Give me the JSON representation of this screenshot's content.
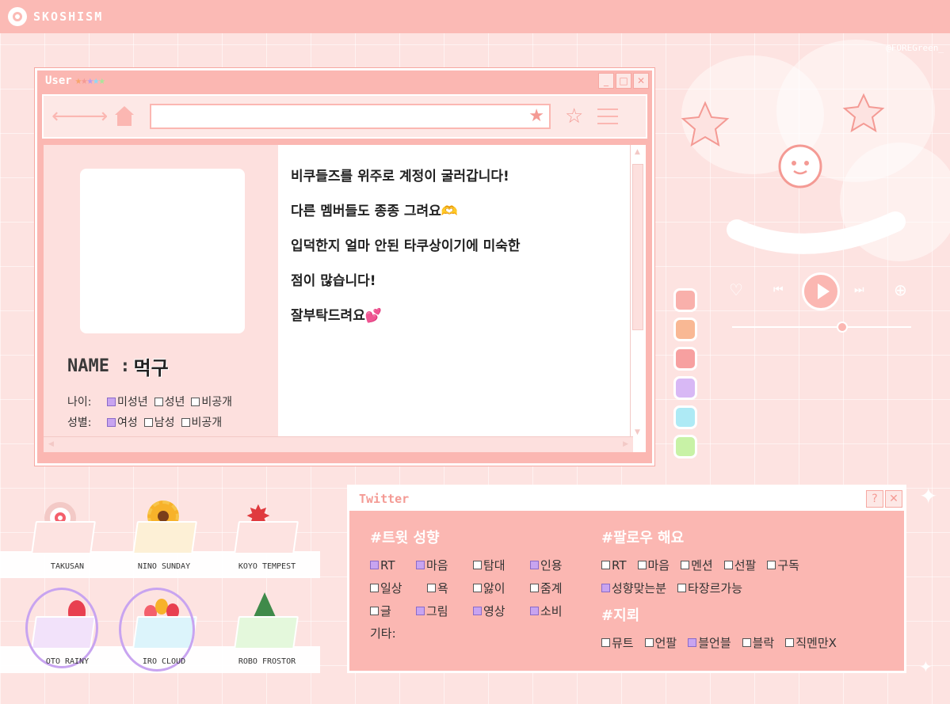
{
  "header": {
    "brand": "SKOSHISM",
    "handle": "@FOREGreen_"
  },
  "window": {
    "title": "User",
    "stars": [
      "★",
      "★",
      "★",
      "★",
      "★"
    ],
    "star_colors": [
      "#f7a46b",
      "#f49a94",
      "#b79cf2",
      "#8fd8f5",
      "#a9e59a"
    ],
    "controls": [
      "_",
      "□",
      "✕"
    ]
  },
  "profile": {
    "name_label": "NAME :",
    "name_value": "먹구",
    "age_label": "나이:",
    "age_options": [
      {
        "label": "미성년",
        "checked": true
      },
      {
        "label": "성년",
        "checked": false
      },
      {
        "label": "비공개",
        "checked": false
      }
    ],
    "gender_label": "성별:",
    "gender_options": [
      {
        "label": "여성",
        "checked": true
      },
      {
        "label": "남성",
        "checked": false
      },
      {
        "label": "비공개",
        "checked": false
      }
    ]
  },
  "bio": [
    "비쿠들즈를 위주로 계정이 굴러갑니다!",
    "다른 멤버들도 종종 그려요🫶",
    "입덕한지 얼마 안된 타쿠상이기에 미숙한",
    "점이 많습니다!",
    "잘부탁드려요💕"
  ],
  "swatch_colors": [
    "#f9b0ab",
    "#f9b894",
    "#f7a0a0",
    "#d8b8f5",
    "#aeeaf5",
    "#c8f2a6"
  ],
  "twitter": {
    "title": "Twitter",
    "controls": [
      "?",
      "✕"
    ],
    "left": {
      "heading": "#트윗 성향",
      "rows": [
        [
          {
            "label": "RT",
            "checked": true
          },
          {
            "label": "마음",
            "checked": true
          },
          {
            "label": "탐대",
            "checked": false
          },
          {
            "label": "인용",
            "checked": true
          }
        ],
        [
          {
            "label": "일상",
            "checked": false
          },
          {
            "label": "욕",
            "checked": false
          },
          {
            "label": "앓이",
            "checked": false
          },
          {
            "label": "줌계",
            "checked": false
          }
        ],
        [
          {
            "label": "글",
            "checked": false
          },
          {
            "label": "그림",
            "checked": true
          },
          {
            "label": "영상",
            "checked": true
          },
          {
            "label": "소비",
            "checked": true
          }
        ]
      ],
      "other": "기타:"
    },
    "right": {
      "heading": "#팔로우 해요",
      "rows": [
        [
          {
            "label": "RT",
            "checked": false
          },
          {
            "label": "마음",
            "checked": false
          },
          {
            "label": "멘션",
            "checked": false
          },
          {
            "label": "선팔",
            "checked": false
          },
          {
            "label": "구독",
            "checked": false
          }
        ],
        [
          {
            "label": "성향맞는분",
            "checked": true
          },
          {
            "label": "타장르가능",
            "checked": false
          }
        ]
      ],
      "heading2": "#지뢰",
      "rows2": [
        [
          {
            "label": "뮤트",
            "checked": false
          },
          {
            "label": "언팔",
            "checked": false
          },
          {
            "label": "블언블",
            "checked": true
          },
          {
            "label": "블락",
            "checked": false
          },
          {
            "label": "직멘만X",
            "checked": false
          }
        ]
      ]
    }
  },
  "folders": [
    {
      "label": "TAKUSAN",
      "color": "#fde3e1",
      "icon": "swirl-icon",
      "selected": false
    },
    {
      "label": "NINO SUNDAY",
      "color": "#fdf0d6",
      "icon": "sunflower-icon",
      "selected": false
    },
    {
      "label": "KOYO TEMPEST",
      "color": "#fde3e1",
      "icon": "maple-leaf-icon",
      "selected": false
    },
    {
      "label": "OTO RAINY",
      "color": "#f2e2fa",
      "icon": "tulip-icon",
      "selected": true
    },
    {
      "label": "IRO CLOUD",
      "color": "#dcf4fb",
      "icon": "tulip-bouquet-icon",
      "selected": true
    },
    {
      "label": "ROBO FROSTOR",
      "color": "#e4f8dc",
      "icon": "pine-tree-icon",
      "selected": false
    }
  ]
}
